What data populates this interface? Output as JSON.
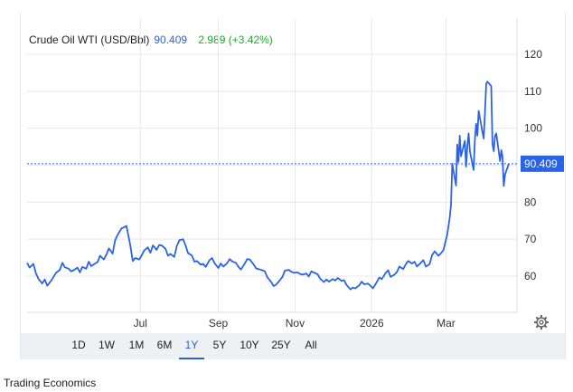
{
  "header": {
    "title": "Crude Oil WTI (USD/Bbl)",
    "price": "90.409",
    "change": "2.989 (+3.42%)"
  },
  "colors": {
    "line": "#2b63e6",
    "price": "#2b63e6",
    "change": "#22a829",
    "grid": "#e6e8eb",
    "price_tag": "#2b63e6"
  },
  "range_buttons": [
    "1D",
    "1W",
    "1M",
    "6M",
    "1Y",
    "5Y",
    "10Y",
    "25Y",
    "All"
  ],
  "active_range": "1Y",
  "footer": "Trading Economics",
  "settings_icon": "gear-icon",
  "chart_data": {
    "type": "line",
    "ylim": [
      48,
      130
    ],
    "yticks": [
      60,
      70,
      80,
      90,
      100,
      110,
      120
    ],
    "xticks": [
      "Jul",
      "Sep",
      "Nov",
      "2026",
      "Mar"
    ],
    "xtick_dates": [
      "2025-07-01",
      "2025-09-01",
      "2025-11-01",
      "2026-01-01",
      "2026-03-01"
    ],
    "last_value_label": "90.409",
    "grid": true,
    "series": [
      {
        "points": [
          [
            "2025-04-02",
            63.6
          ],
          [
            "2025-04-04",
            62.3
          ],
          [
            "2025-04-07",
            63.3
          ],
          [
            "2025-04-09",
            60.8
          ],
          [
            "2025-04-11",
            59.3
          ],
          [
            "2025-04-14",
            58.0
          ],
          [
            "2025-04-16",
            59.1
          ],
          [
            "2025-04-18",
            57.4
          ],
          [
            "2025-04-21",
            58.7
          ],
          [
            "2025-04-23",
            59.8
          ],
          [
            "2025-04-25",
            60.9
          ],
          [
            "2025-04-28",
            61.7
          ],
          [
            "2025-04-30",
            63.6
          ],
          [
            "2025-05-02",
            62.4
          ],
          [
            "2025-05-05",
            62.0
          ],
          [
            "2025-05-07",
            61.3
          ],
          [
            "2025-05-09",
            61.6
          ],
          [
            "2025-05-12",
            62.3
          ],
          [
            "2025-05-14",
            61.0
          ],
          [
            "2025-05-16",
            62.5
          ],
          [
            "2025-05-19",
            62.0
          ],
          [
            "2025-05-21",
            63.9
          ],
          [
            "2025-05-23",
            62.7
          ],
          [
            "2025-05-26",
            63.4
          ],
          [
            "2025-05-28",
            63.8
          ],
          [
            "2025-05-30",
            65.5
          ],
          [
            "2025-06-02",
            64.5
          ],
          [
            "2025-06-04",
            65.8
          ],
          [
            "2025-06-06",
            67.5
          ],
          [
            "2025-06-09",
            66.1
          ],
          [
            "2025-06-11",
            69.7
          ],
          [
            "2025-06-13",
            71.2
          ],
          [
            "2025-06-16",
            72.9
          ],
          [
            "2025-06-18",
            73.2
          ],
          [
            "2025-06-20",
            73.6
          ],
          [
            "2025-06-23",
            68.4
          ],
          [
            "2025-06-25",
            64.1
          ],
          [
            "2025-06-27",
            64.9
          ],
          [
            "2025-06-30",
            64.5
          ],
          [
            "2025-07-02",
            65.5
          ],
          [
            "2025-07-04",
            66.9
          ],
          [
            "2025-07-07",
            67.8
          ],
          [
            "2025-07-09",
            66.3
          ],
          [
            "2025-07-11",
            68.3
          ],
          [
            "2025-07-14",
            67.1
          ],
          [
            "2025-07-16",
            68.4
          ],
          [
            "2025-07-18",
            68.3
          ],
          [
            "2025-07-21",
            67.4
          ],
          [
            "2025-07-23",
            65.5
          ],
          [
            "2025-07-25",
            66.0
          ],
          [
            "2025-07-28",
            65.2
          ],
          [
            "2025-07-30",
            68.1
          ],
          [
            "2025-08-01",
            69.7
          ],
          [
            "2025-08-04",
            70.0
          ],
          [
            "2025-08-06",
            68.3
          ],
          [
            "2025-08-08",
            66.2
          ],
          [
            "2025-08-11",
            65.6
          ],
          [
            "2025-08-13",
            63.9
          ],
          [
            "2025-08-15",
            64.1
          ],
          [
            "2025-08-18",
            63.1
          ],
          [
            "2025-08-20",
            63.3
          ],
          [
            "2025-08-22",
            62.5
          ],
          [
            "2025-08-25",
            64.3
          ],
          [
            "2025-08-27",
            64.9
          ],
          [
            "2025-08-29",
            63.5
          ],
          [
            "2025-09-01",
            62.2
          ],
          [
            "2025-09-03",
            63.4
          ],
          [
            "2025-09-05",
            62.6
          ],
          [
            "2025-09-08",
            63.5
          ],
          [
            "2025-09-10",
            64.6
          ],
          [
            "2025-09-12",
            64.0
          ],
          [
            "2025-09-15",
            63.6
          ],
          [
            "2025-09-17",
            62.5
          ],
          [
            "2025-09-19",
            61.8
          ],
          [
            "2025-09-22",
            63.4
          ],
          [
            "2025-09-24",
            64.6
          ],
          [
            "2025-09-26",
            64.5
          ],
          [
            "2025-09-29",
            63.2
          ],
          [
            "2025-10-01",
            62.1
          ],
          [
            "2025-10-03",
            61.9
          ],
          [
            "2025-10-06",
            61.6
          ],
          [
            "2025-10-08",
            61.3
          ],
          [
            "2025-10-10",
            59.7
          ],
          [
            "2025-10-13",
            58.4
          ],
          [
            "2025-10-15",
            57.3
          ],
          [
            "2025-10-17",
            57.7
          ],
          [
            "2025-10-20",
            58.9
          ],
          [
            "2025-10-22",
            59.8
          ],
          [
            "2025-10-24",
            61.5
          ],
          [
            "2025-10-27",
            61.7
          ],
          [
            "2025-10-29",
            61.2
          ],
          [
            "2025-10-31",
            60.9
          ],
          [
            "2025-11-03",
            61.0
          ],
          [
            "2025-11-05",
            60.6
          ],
          [
            "2025-11-07",
            60.4
          ],
          [
            "2025-11-10",
            60.7
          ],
          [
            "2025-11-12",
            59.9
          ],
          [
            "2025-11-14",
            61.3
          ],
          [
            "2025-11-17",
            60.8
          ],
          [
            "2025-11-19",
            60.5
          ],
          [
            "2025-11-21",
            59.3
          ],
          [
            "2025-11-24",
            58.4
          ],
          [
            "2025-11-26",
            59.1
          ],
          [
            "2025-11-28",
            58.5
          ],
          [
            "2025-12-01",
            59.2
          ],
          [
            "2025-12-03",
            58.8
          ],
          [
            "2025-12-05",
            59.5
          ],
          [
            "2025-12-08",
            58.7
          ],
          [
            "2025-12-10",
            58.9
          ],
          [
            "2025-12-12",
            57.6
          ],
          [
            "2025-12-15",
            56.4
          ],
          [
            "2025-12-17",
            56.9
          ],
          [
            "2025-12-19",
            56.7
          ],
          [
            "2025-12-22",
            57.5
          ],
          [
            "2025-12-24",
            58.5
          ],
          [
            "2025-12-26",
            57.8
          ],
          [
            "2025-12-29",
            58.0
          ],
          [
            "2025-12-31",
            57.4
          ],
          [
            "2026-01-02",
            56.7
          ],
          [
            "2026-01-05",
            58.4
          ],
          [
            "2026-01-07",
            59.6
          ],
          [
            "2026-01-09",
            59.2
          ],
          [
            "2026-01-12",
            60.8
          ],
          [
            "2026-01-14",
            61.6
          ],
          [
            "2026-01-16",
            59.8
          ],
          [
            "2026-01-19",
            60.4
          ],
          [
            "2026-01-21",
            61.1
          ],
          [
            "2026-01-23",
            62.6
          ],
          [
            "2026-01-26",
            61.9
          ],
          [
            "2026-01-28",
            63.2
          ],
          [
            "2026-01-30",
            64.1
          ],
          [
            "2026-02-02",
            63.4
          ],
          [
            "2026-02-04",
            63.9
          ],
          [
            "2026-02-06",
            62.6
          ],
          [
            "2026-02-09",
            63.6
          ],
          [
            "2026-02-11",
            64.3
          ],
          [
            "2026-02-13",
            62.6
          ],
          [
            "2026-02-16",
            63.2
          ],
          [
            "2026-02-18",
            65.7
          ],
          [
            "2026-02-20",
            66.7
          ],
          [
            "2026-02-23",
            65.5
          ],
          [
            "2026-02-25",
            66.2
          ],
          [
            "2026-02-27",
            67.0
          ],
          [
            "2026-03-02",
            71.2
          ],
          [
            "2026-03-04",
            75.8
          ],
          [
            "2026-03-05",
            79.2
          ],
          [
            "2026-03-06",
            90.4
          ],
          [
            "2026-03-09",
            84.5
          ],
          [
            "2026-03-10",
            95.6
          ],
          [
            "2026-03-11",
            90.9
          ],
          [
            "2026-03-12",
            98.0
          ],
          [
            "2026-03-13",
            92.4
          ],
          [
            "2026-03-16",
            96.6
          ],
          [
            "2026-03-17",
            89.6
          ],
          [
            "2026-03-18",
            95.2
          ],
          [
            "2026-03-19",
            98.6
          ],
          [
            "2026-03-20",
            93.8
          ],
          [
            "2026-03-23",
            88.7
          ],
          [
            "2026-03-24",
            96.7
          ],
          [
            "2026-03-25",
            101.2
          ],
          [
            "2026-03-26",
            98.0
          ],
          [
            "2026-03-27",
            104.7
          ],
          [
            "2026-03-30",
            99.0
          ],
          [
            "2026-03-31",
            97.2
          ],
          [
            "2026-04-01",
            104.2
          ],
          [
            "2026-04-02",
            112.1
          ],
          [
            "2026-04-03",
            112.6
          ],
          [
            "2026-04-06",
            111.4
          ],
          [
            "2026-04-07",
            95.7
          ],
          [
            "2026-04-08",
            93.8
          ],
          [
            "2026-04-09",
            97.9
          ],
          [
            "2026-04-10",
            98.6
          ],
          [
            "2026-04-13",
            91.1
          ],
          [
            "2026-04-14",
            94.1
          ],
          [
            "2026-04-15",
            92.3
          ],
          [
            "2026-04-16",
            84.4
          ],
          [
            "2026-04-17",
            87.5
          ],
          [
            "2026-04-20",
            90.409
          ]
        ]
      }
    ]
  }
}
